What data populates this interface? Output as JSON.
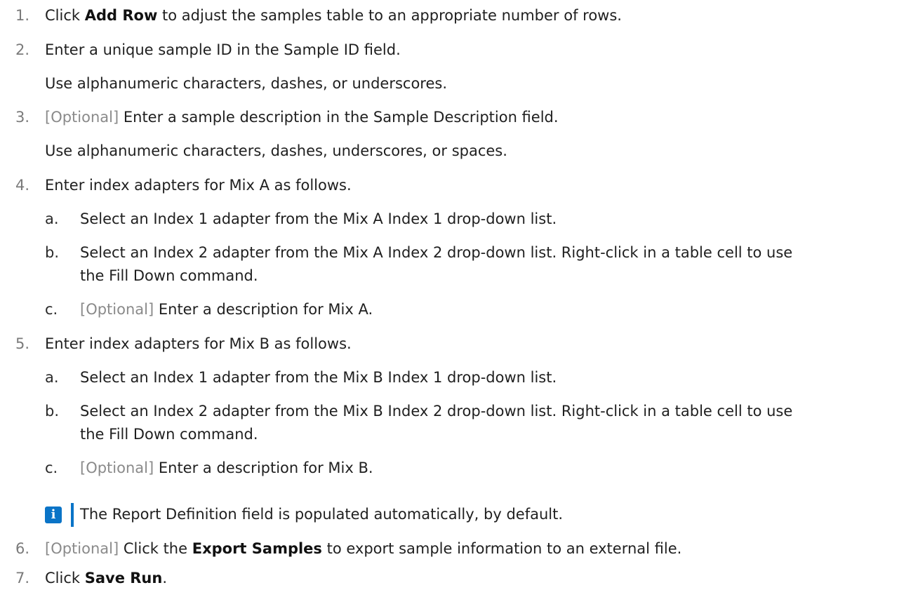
{
  "steps": {
    "s1": {
      "num": "1.",
      "pre": "Click ",
      "bold": "Add Row",
      "post": " to adjust the samples table to an appropriate number of rows."
    },
    "s2": {
      "num": "2.",
      "text": "Enter a unique sample ID in the Sample ID field.",
      "sub": "Use alphanumeric characters, dashes, or underscores."
    },
    "s3": {
      "num": "3.",
      "opt": "[Optional]",
      "text": " Enter a sample description in the Sample Description field.",
      "sub": "Use alphanumeric characters, dashes, underscores, or spaces."
    },
    "s4": {
      "num": "4.",
      "text": "Enter index adapters for Mix A as follows.",
      "a": {
        "letter": "a.",
        "text": "Select an Index 1 adapter from the Mix A Index 1 drop-down list."
      },
      "b": {
        "letter": "b.",
        "text": "Select an Index 2 adapter from the Mix A Index 2 drop-down list. Right-click in a table cell to use",
        "cont": "the Fill Down command."
      },
      "c": {
        "letter": "c.",
        "opt": "[Optional]",
        "text": " Enter a description for Mix A."
      }
    },
    "s5": {
      "num": "5.",
      "text": "Enter index adapters for Mix B as follows.",
      "a": {
        "letter": "a.",
        "text": "Select an Index 1 adapter from the Mix B Index 1 drop-down list."
      },
      "b": {
        "letter": "b.",
        "text": "Select an Index 2 adapter from the Mix B Index 2 drop-down list. Right-click in a table cell to use",
        "cont": "the Fill Down command."
      },
      "c": {
        "letter": "c.",
        "opt": "[Optional]",
        "text": " Enter a description for Mix B."
      }
    },
    "note": {
      "icon": "info-icon",
      "icon_glyph": "i",
      "text": "The Report Definition field is populated automatically, by default."
    },
    "s6": {
      "num": "6.",
      "opt": "[Optional]",
      "pre": " Click the ",
      "bold": "Export Samples",
      "post": " to export sample information to an external file."
    },
    "s7": {
      "num": "7.",
      "pre": "Click ",
      "bold": "Save Run",
      "post": "."
    }
  },
  "colors": {
    "accent": "#0a74c7",
    "muted": "#8a8a8a"
  }
}
